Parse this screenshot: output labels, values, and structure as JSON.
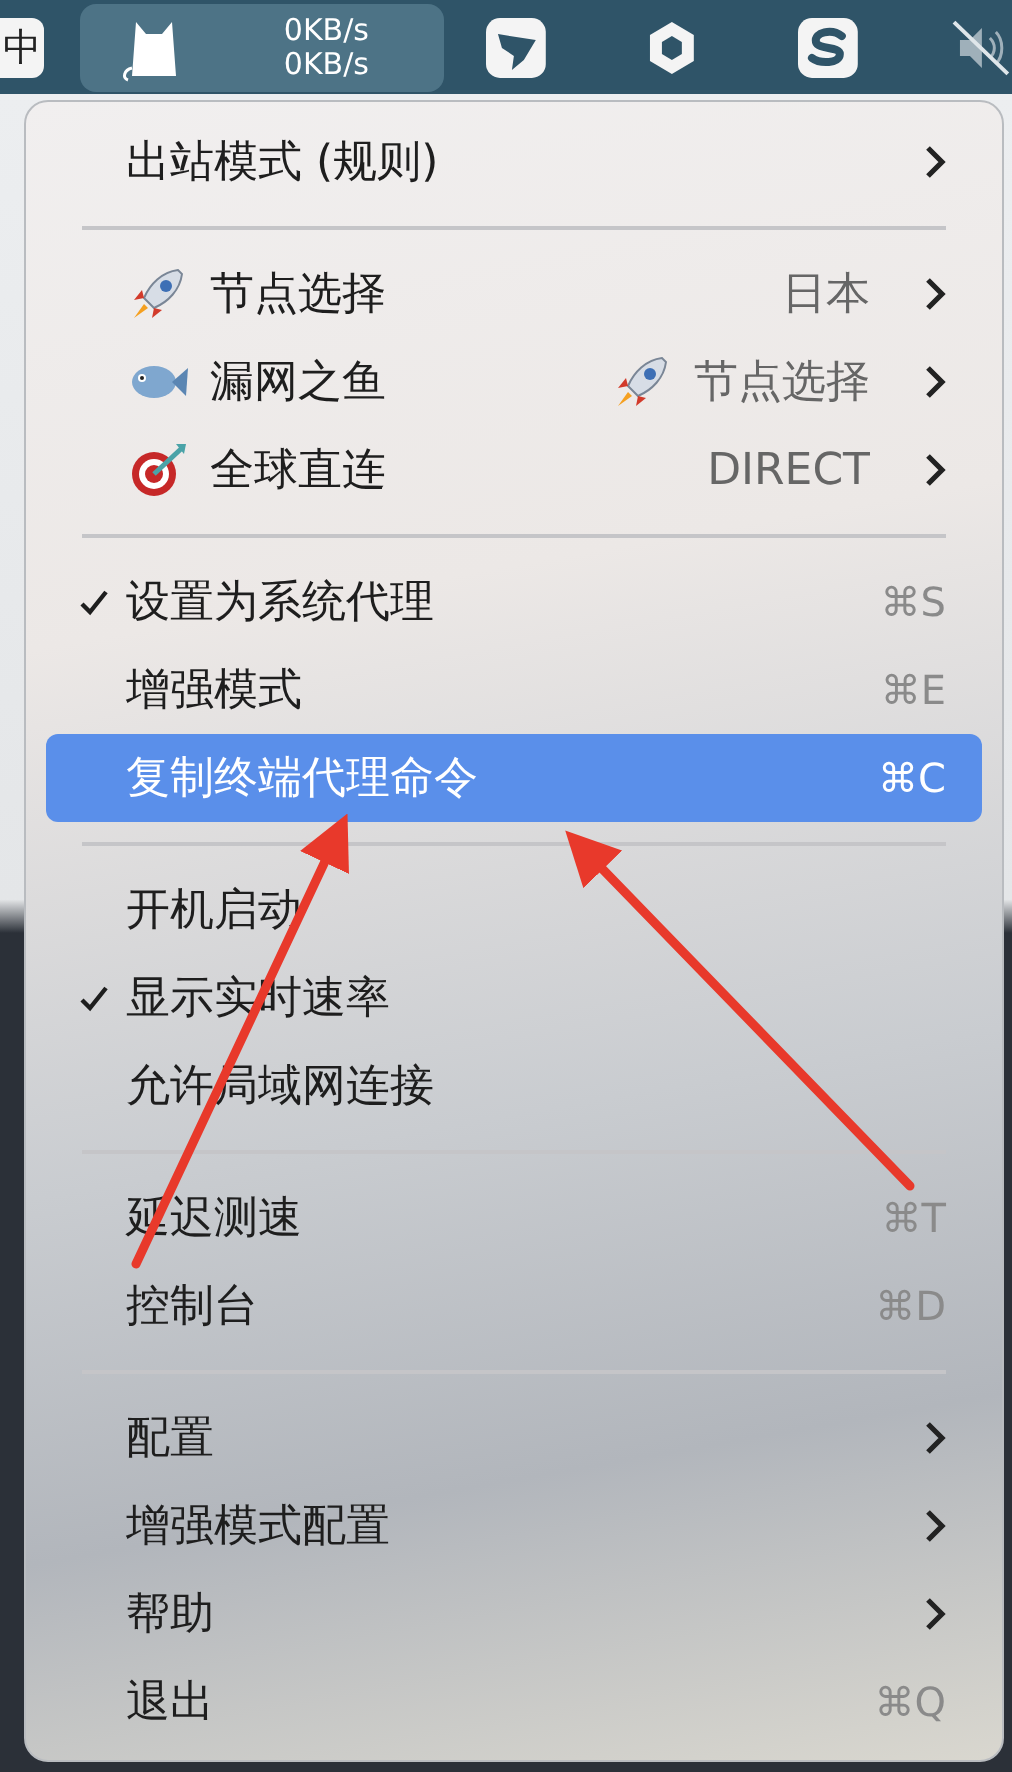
{
  "menubar": {
    "input_method": "中",
    "speeds": [
      "0KB/s",
      "0KB/s"
    ]
  },
  "menu": {
    "sections": [
      [
        {
          "label": "出站模式 (规则)",
          "checked": false,
          "submenu": true,
          "selected": false
        }
      ],
      [
        {
          "label": "节点选择",
          "value": "日本",
          "checked": false,
          "submenu": true,
          "selected": false
        },
        {
          "label": "漏网之鱼",
          "value": "节点选择",
          "checked": false,
          "submenu": true,
          "selected": false
        },
        {
          "label": "全球直连",
          "value": "DIRECT",
          "checked": false,
          "submenu": true,
          "selected": false
        }
      ],
      [
        {
          "label": "设置为系统代理",
          "shortcut": "⌘S",
          "checked": true,
          "submenu": false,
          "selected": false
        },
        {
          "label": "增强模式",
          "shortcut": "⌘E",
          "checked": false,
          "submenu": false,
          "selected": false
        },
        {
          "label": "复制终端代理命令",
          "shortcut": "⌘C",
          "checked": false,
          "submenu": false,
          "selected": true
        }
      ],
      [
        {
          "label": "开机启动",
          "checked": false,
          "submenu": false,
          "selected": false
        },
        {
          "label": "显示实时速率",
          "checked": true,
          "submenu": false,
          "selected": false
        },
        {
          "label": "允许局域网连接",
          "checked": false,
          "submenu": false,
          "selected": false
        }
      ],
      [
        {
          "label": "延迟测速",
          "shortcut": "⌘T",
          "checked": false,
          "submenu": false,
          "selected": false
        },
        {
          "label": "控制台",
          "shortcut": "⌘D",
          "checked": false,
          "submenu": false,
          "selected": false
        }
      ],
      [
        {
          "label": "配置",
          "checked": false,
          "submenu": true,
          "selected": false
        },
        {
          "label": "增强模式配置",
          "checked": false,
          "submenu": true,
          "selected": false
        },
        {
          "label": "帮助",
          "checked": false,
          "submenu": true,
          "selected": false
        },
        {
          "label": "退出",
          "shortcut": "⌘Q",
          "checked": false,
          "submenu": false,
          "selected": false
        }
      ]
    ]
  }
}
